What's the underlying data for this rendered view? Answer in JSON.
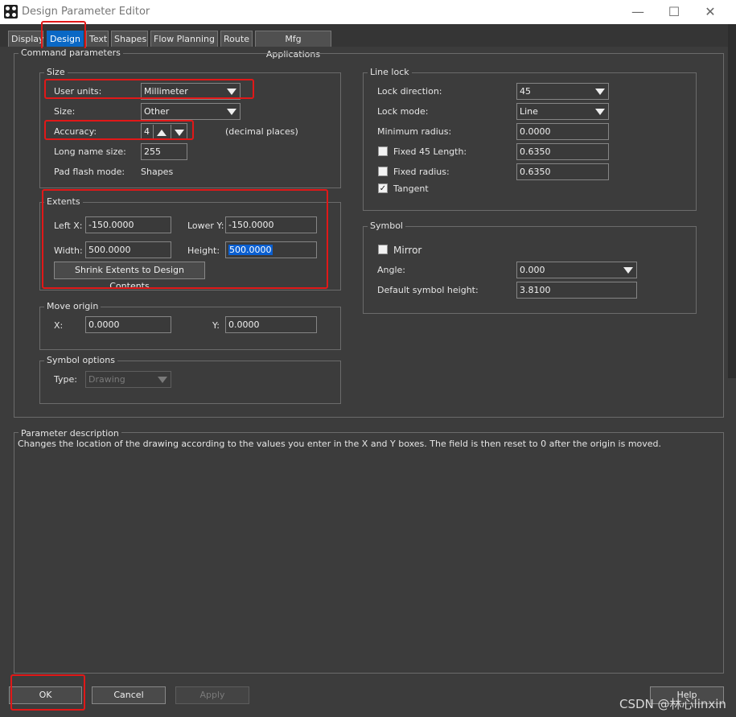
{
  "window": {
    "title": "Design Parameter Editor",
    "minimize": "—",
    "maximize": "☐",
    "close": "✕"
  },
  "tabs": [
    {
      "label": "Display"
    },
    {
      "label": "Design",
      "active": true
    },
    {
      "label": "Text"
    },
    {
      "label": "Shapes"
    },
    {
      "label": "Flow Planning"
    },
    {
      "label": "Route"
    },
    {
      "label": "Mfg Applications"
    }
  ],
  "command_parameters": {
    "title": "Command parameters"
  },
  "size": {
    "title": "Size",
    "user_units_label": "User units:",
    "user_units_value": "Millimeter",
    "size_label": "Size:",
    "size_value": "Other",
    "accuracy_label": "Accuracy:",
    "accuracy_value": "4",
    "accuracy_note": "(decimal places)",
    "long_name_label": "Long name size:",
    "long_name_value": "255",
    "pad_flash_label": "Pad flash mode:",
    "pad_flash_value": "Shapes"
  },
  "extents": {
    "title": "Extents",
    "left_x_label": "Left X:",
    "left_x_value": "-150.0000",
    "lower_y_label": "Lower Y:",
    "lower_y_value": "-150.0000",
    "width_label": "Width:",
    "width_value": "500.0000",
    "height_label": "Height:",
    "height_value": "500.0000",
    "shrink_button": "Shrink Extents to Design Contents"
  },
  "move_origin": {
    "title": "Move origin",
    "x_label": "X:",
    "x_value": "0.0000",
    "y_label": "Y:",
    "y_value": "0.0000"
  },
  "symbol_options": {
    "title": "Symbol options",
    "type_label": "Type:",
    "type_value": "Drawing"
  },
  "line_lock": {
    "title": "Line lock",
    "lock_direction_label": "Lock direction:",
    "lock_direction_value": "45",
    "lock_mode_label": "Lock mode:",
    "lock_mode_value": "Line",
    "min_radius_label": "Minimum radius:",
    "min_radius_value": "0.0000",
    "fixed45_label": "Fixed 45 Length:",
    "fixed45_value": "0.6350",
    "fixed45_checked": false,
    "fixed_radius_label": "Fixed radius:",
    "fixed_radius_value": "0.6350",
    "fixed_radius_checked": false,
    "tangent_label": "Tangent",
    "tangent_checked": true,
    "check_mark": "✓"
  },
  "symbol": {
    "title": "Symbol",
    "mirror_label": "Mirror",
    "mirror_checked": false,
    "angle_label": "Angle:",
    "angle_value": "0.000",
    "default_height_label": "Default symbol height:",
    "default_height_value": "3.8100"
  },
  "parameter_description": {
    "title": "Parameter description",
    "text": "Changes the location of the drawing according to the values you enter in the X and Y boxes. The field is then reset to 0 after the origin is moved."
  },
  "buttons": {
    "ok": "OK",
    "cancel": "Cancel",
    "apply": "Apply",
    "help": "Help"
  },
  "watermark": "CSDN @林心linxin",
  "colors": {
    "accent": "#0a68c5",
    "annotation_red": "#e11818",
    "background": "#3c3c3c"
  }
}
